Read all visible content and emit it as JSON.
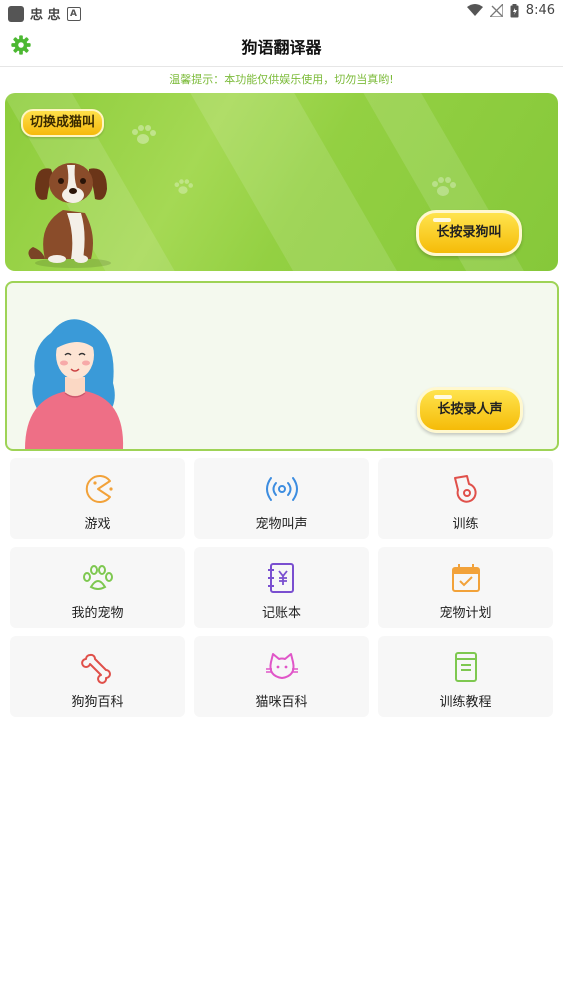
{
  "status_bar": {
    "left_glyph": "忠 忠",
    "a_badge": "A",
    "time": "8:46"
  },
  "header": {
    "title": "狗语翻译器",
    "settings_icon": "gear-icon"
  },
  "notice": "温馨提示：本功能仅供娱乐使用，切勿当真哟!",
  "dog_panel": {
    "switch_label": "切换成猫叫",
    "record_label": "长按录狗叫"
  },
  "human_panel": {
    "record_label": "长按录人声"
  },
  "features": [
    {
      "label": "游戏",
      "icon": "pacman-icon",
      "color": "#f2a23a"
    },
    {
      "label": "宠物叫声",
      "icon": "broadcast-icon",
      "color": "#3d8de0"
    },
    {
      "label": "训练",
      "icon": "whistle-icon",
      "color": "#e0504a"
    },
    {
      "label": "我的宠物",
      "icon": "paw-icon",
      "color": "#7ec850"
    },
    {
      "label": "记账本",
      "icon": "ledger-icon",
      "color": "#7a4fd0"
    },
    {
      "label": "宠物计划",
      "icon": "calendar-check-icon",
      "color": "#f2a23a"
    },
    {
      "label": "狗狗百科",
      "icon": "bone-icon",
      "color": "#e0504a"
    },
    {
      "label": "猫咪百科",
      "icon": "cat-face-icon",
      "color": "#e056c8"
    },
    {
      "label": "训练教程",
      "icon": "book-icon",
      "color": "#7ec850"
    }
  ]
}
